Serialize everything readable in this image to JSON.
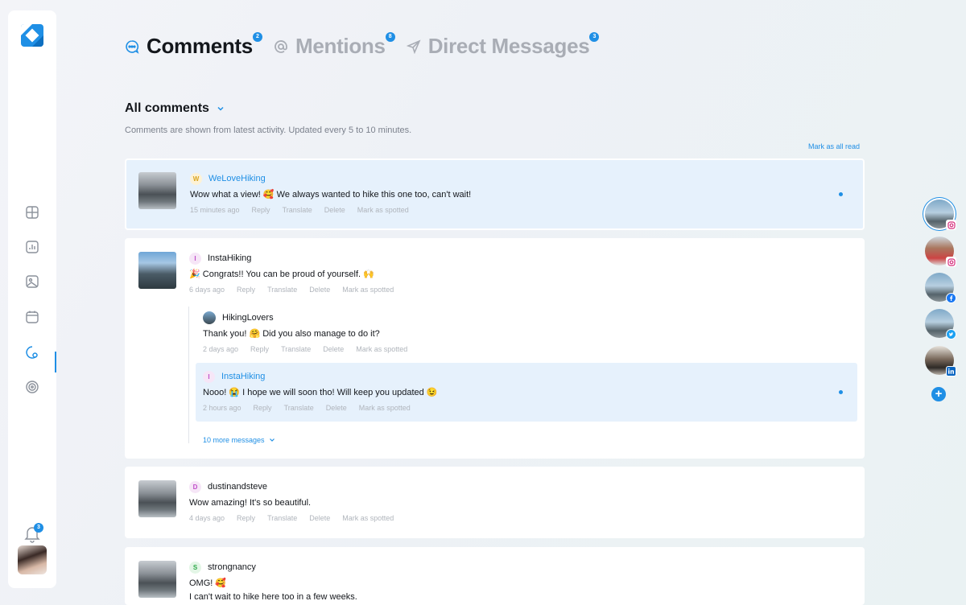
{
  "tabs": [
    {
      "label": "Comments",
      "badge": "2",
      "icon": "chat-bubble-icon"
    },
    {
      "label": "Mentions",
      "badge": "8",
      "icon": "at-icon"
    },
    {
      "label": "Direct Messages",
      "badge": "3",
      "icon": "send-icon"
    }
  ],
  "filter": {
    "label": "All comments"
  },
  "subtitle": "Comments are shown from latest activity. Updated every 5 to 10 minutes.",
  "mark_all_read": "Mark as all read",
  "actions": {
    "reply": "Reply",
    "translate": "Translate",
    "delete": "Delete",
    "spotted": "Mark as spotted"
  },
  "sidebar": {
    "notifications_badge": "3"
  },
  "comments": [
    {
      "initial": "W",
      "author": "WeLoveHiking",
      "text": "Wow what a view! 🥰 We always wanted to hike this one too, can't wait!",
      "time": "15 minutes ago"
    },
    {
      "initial": "I",
      "author": "InstaHiking",
      "text": "🎉 Congrats!! You can be proud of yourself. 🙌",
      "time": "6 days ago",
      "replies": [
        {
          "author": "HikingLovers",
          "text": "Thank you! 🤗 Did you also manage to do it?",
          "time": "2 days ago"
        },
        {
          "initial": "I",
          "author": "InstaHiking",
          "text": "Nooo! 😭 I hope we will soon tho! Will keep you updated 😉",
          "time": "2 hours ago"
        }
      ],
      "more": "10 more messages"
    },
    {
      "initial": "D",
      "author": "dustinandsteve",
      "text": "Wow amazing! It's so beautiful.",
      "time": "4 days ago"
    },
    {
      "initial": "S",
      "author": "strongnancy",
      "text": "OMG! 🥰",
      "text2": "I can't wait to hike here too in a few weeks."
    }
  ],
  "colors": {
    "accent": "#1f8fe5",
    "highlight": "#e6f1fc"
  }
}
